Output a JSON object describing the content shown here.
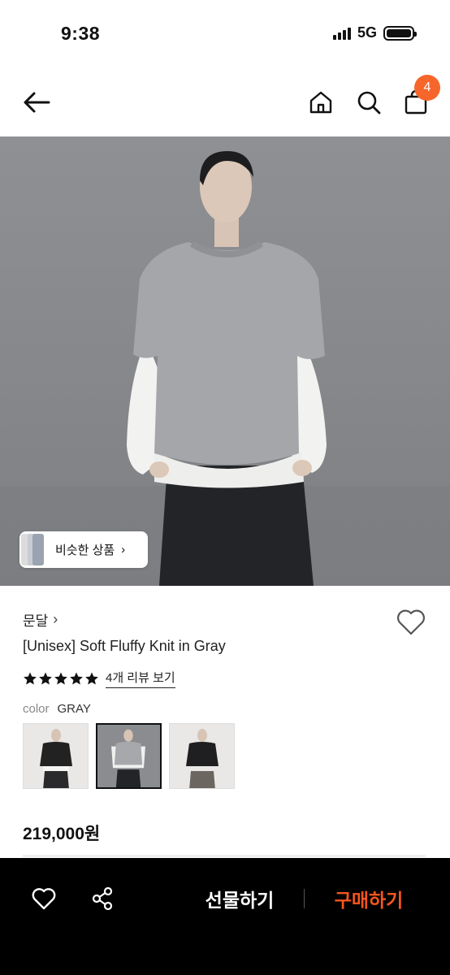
{
  "status_bar": {
    "time": "9:38",
    "network": "5G"
  },
  "header": {
    "back_icon": "arrow-left-icon",
    "home_icon": "home-icon",
    "search_icon": "search-icon",
    "cart_icon": "shopping-bag-icon",
    "cart_count": "4"
  },
  "hero": {
    "similar_label": "비슷한 상품",
    "similar_chevron": "›"
  },
  "product": {
    "brand": "문달",
    "brand_chevron": "›",
    "title": "[Unisex] Soft Fluffy Knit in Gray",
    "rating": 5,
    "rating_max": 5,
    "review_link": "4개 리뷰 보기",
    "color_label": "color",
    "color_value": "GRAY",
    "swatches": [
      {
        "name": "black",
        "selected": false
      },
      {
        "name": "gray",
        "selected": true
      },
      {
        "name": "black-2",
        "selected": false
      }
    ],
    "price": "219,000원"
  },
  "bottom_bar": {
    "gift_label": "선물하기",
    "buy_label": "구매하기"
  },
  "colors": {
    "accent": "#f6551e",
    "badge": "#f6662a",
    "bottom_bar_bg": "#000000"
  }
}
